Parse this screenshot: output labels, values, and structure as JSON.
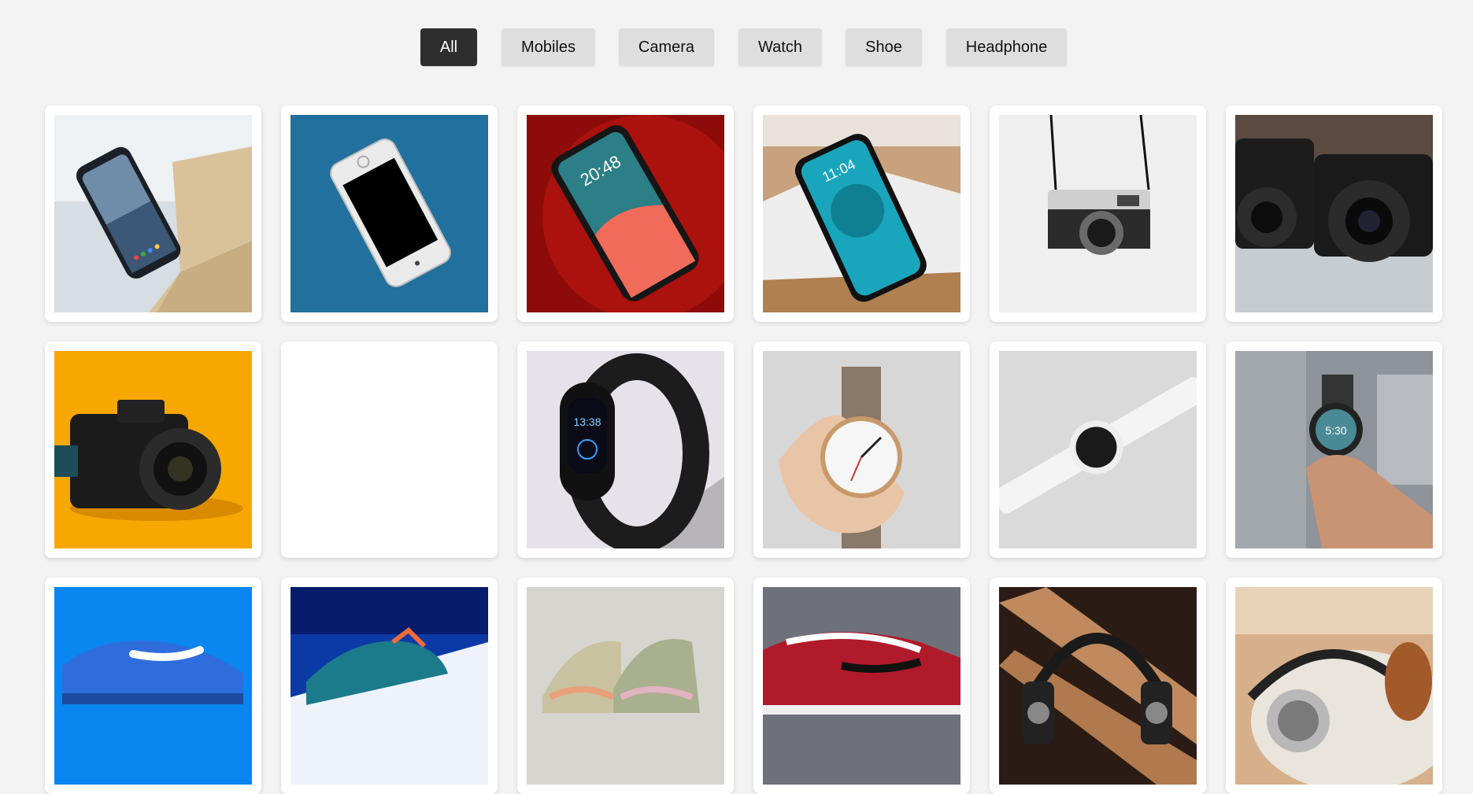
{
  "filters": [
    {
      "label": "All",
      "active": true
    },
    {
      "label": "Mobiles",
      "active": false
    },
    {
      "label": "Camera",
      "active": false
    },
    {
      "label": "Watch",
      "active": false
    },
    {
      "label": "Shoe",
      "active": false
    },
    {
      "label": "Headphone",
      "active": false
    }
  ],
  "products": [
    {
      "category": "Mobiles",
      "icon": "smartphone-on-table-image",
      "bg": "#c9d3dc"
    },
    {
      "category": "Mobiles",
      "icon": "white-iphone-on-blue-carpet-image",
      "bg": "#1d6b96"
    },
    {
      "category": "Mobiles",
      "icon": "iphone-on-red-background-image",
      "bg": "#b0140f"
    },
    {
      "category": "Mobiles",
      "icon": "iphone-on-box-image",
      "bg": "#c9a27a"
    },
    {
      "category": "Camera",
      "icon": "rangefinder-camera-image",
      "bg": "#efefef"
    },
    {
      "category": "Camera",
      "icon": "two-canon-dslr-image",
      "bg": "#c2c7cc"
    },
    {
      "category": "Camera",
      "icon": "canon-dslr-on-orange-image",
      "bg": "#f7a800"
    },
    {
      "category": "Camera",
      "icon": "blank-image",
      "bg": "#ffffff"
    },
    {
      "category": "Watch",
      "icon": "fitness-band-image",
      "bg": "#e4e0e8"
    },
    {
      "category": "Watch",
      "icon": "hand-holding-watch-image",
      "bg": "#d9d9d9"
    },
    {
      "category": "Watch",
      "icon": "white-smartwatch-image",
      "bg": "#dcdcdc"
    },
    {
      "category": "Watch",
      "icon": "hand-with-smartwatch-image",
      "bg": "#8a8f95"
    },
    {
      "category": "Shoe",
      "icon": "blue-sneaker-image",
      "bg": "#0a84ef"
    },
    {
      "category": "Shoe",
      "icon": "teal-sneaker-image",
      "bg": "#0a3aa8"
    },
    {
      "category": "Shoe",
      "icon": "pastel-sneakers-image",
      "bg": "#d8d6d2"
    },
    {
      "category": "Shoe",
      "icon": "red-black-sneaker-image",
      "bg": "#6d7078"
    },
    {
      "category": "Headphone",
      "icon": "headphones-on-wood-image",
      "bg": "#3a2a20"
    },
    {
      "category": "Headphone",
      "icon": "brown-headphones-image",
      "bg": "#c8a27c"
    }
  ]
}
